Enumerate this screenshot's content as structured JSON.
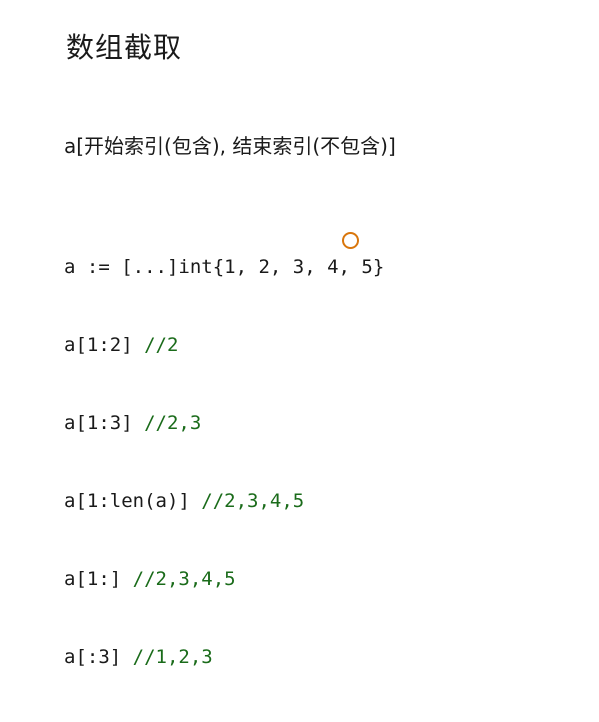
{
  "slide": {
    "title": "数组截取",
    "syntax": "a[开始索引(包含), 结束索引(不包含)]",
    "code_lines": [
      {
        "code": "a := [...]int{1, 2, 3, 4, 5}",
        "comment": ""
      },
      {
        "code": "a[1:2] ",
        "comment": "//2"
      },
      {
        "code": "a[1:3] ",
        "comment": "//2,3"
      },
      {
        "code": "a[1:len(a)] ",
        "comment": "//2,3,4,5"
      },
      {
        "code": "a[1:] ",
        "comment": "//2,3,4,5"
      },
      {
        "code": "a[:3] ",
        "comment": "//1,2,3"
      }
    ]
  },
  "colors": {
    "text": "#1a1a1a",
    "comment": "#1a6b1a",
    "cursor_ring": "#d9760c"
  }
}
